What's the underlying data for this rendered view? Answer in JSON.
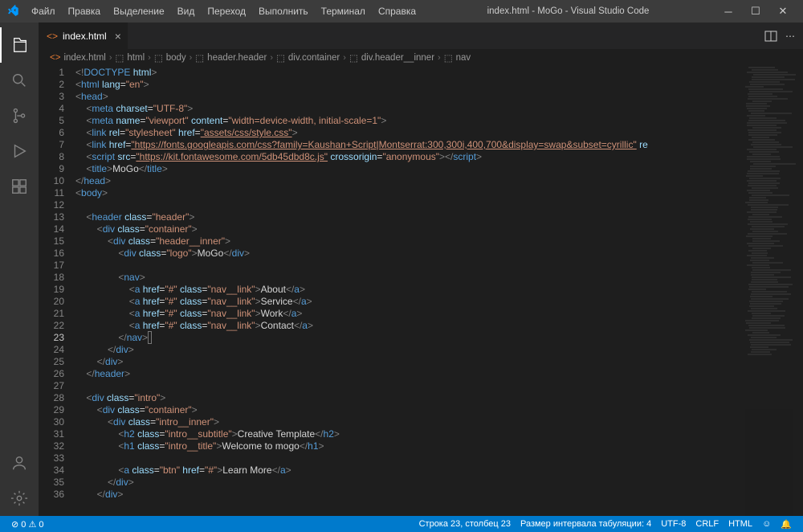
{
  "title": "index.html - MoGo - Visual Studio Code",
  "menu": [
    "Файл",
    "Правка",
    "Выделение",
    "Вид",
    "Переход",
    "Выполнить",
    "Терминал",
    "Справка"
  ],
  "tab": {
    "name": "index.html"
  },
  "breadcrumb": [
    "index.html",
    "html",
    "body",
    "header.header",
    "div.container",
    "div.header__inner",
    "nav"
  ],
  "code": {
    "lines": [
      {
        "n": 1,
        "html": "<span class='t-pct'>&lt;!</span><span class='t-doctype'>DOCTYPE</span> <span class='t-attr'>html</span><span class='t-pct'>&gt;</span>"
      },
      {
        "n": 2,
        "html": "<span class='t-pct'>&lt;</span><span class='t-tag'>html</span> <span class='t-attr'>lang</span>=<span class='t-str'>\"en\"</span><span class='t-pct'>&gt;</span>"
      },
      {
        "n": 3,
        "html": "<span class='t-pct'>&lt;</span><span class='t-tag'>head</span><span class='t-pct'>&gt;</span>"
      },
      {
        "n": 4,
        "html": "    <span class='t-pct'>&lt;</span><span class='t-tag'>meta</span> <span class='t-attr'>charset</span>=<span class='t-str'>\"UTF-8\"</span><span class='t-pct'>&gt;</span>"
      },
      {
        "n": 5,
        "html": "    <span class='t-pct'>&lt;</span><span class='t-tag'>meta</span> <span class='t-attr'>name</span>=<span class='t-str'>\"viewport\"</span> <span class='t-attr'>content</span>=<span class='t-str'>\"width=device-width, initial-scale=1\"</span><span class='t-pct'>&gt;</span>"
      },
      {
        "n": 6,
        "html": "    <span class='t-pct'>&lt;</span><span class='t-tag'>link</span> <span class='t-attr'>rel</span>=<span class='t-str'>\"stylesheet\"</span> <span class='t-attr'>href</span>=<span class='t-link'>\"assets/css/style.css\"</span><span class='t-pct'>&gt;</span>"
      },
      {
        "n": 7,
        "html": "    <span class='t-pct'>&lt;</span><span class='t-tag'>link</span> <span class='t-attr'>href</span>=<span class='t-link'>\"https://fonts.googleapis.com/css?family=Kaushan+Script|Montserrat:300,300i,400,700&amp;display=swap&amp;subset=cyrillic\"</span> <span class='t-attr'>re</span>"
      },
      {
        "n": 8,
        "html": "    <span class='t-pct'>&lt;</span><span class='t-tag'>script</span> <span class='t-attr'>src</span>=<span class='t-link'>\"https://kit.fontawesome.com/5db45dbd8c.js\"</span> <span class='t-attr'>crossorigin</span>=<span class='t-str'>\"anonymous\"</span><span class='t-pct'>&gt;&lt;/</span><span class='t-tag'>script</span><span class='t-pct'>&gt;</span>"
      },
      {
        "n": 9,
        "html": "    <span class='t-pct'>&lt;</span><span class='t-tag'>title</span><span class='t-pct'>&gt;</span><span class='t-text'>MoGo</span><span class='t-pct'>&lt;/</span><span class='t-tag'>title</span><span class='t-pct'>&gt;</span>"
      },
      {
        "n": 10,
        "html": "<span class='t-pct'>&lt;/</span><span class='t-tag'>head</span><span class='t-pct'>&gt;</span>"
      },
      {
        "n": 11,
        "html": "<span class='t-pct'>&lt;</span><span class='t-tag'>body</span><span class='t-pct'>&gt;</span>"
      },
      {
        "n": 12,
        "html": ""
      },
      {
        "n": 13,
        "html": "    <span class='t-pct'>&lt;</span><span class='t-tag'>header</span> <span class='t-attr'>class</span>=<span class='t-str'>\"header\"</span><span class='t-pct'>&gt;</span>"
      },
      {
        "n": 14,
        "html": "        <span class='t-pct'>&lt;</span><span class='t-tag'>div</span> <span class='t-attr'>class</span>=<span class='t-str'>\"container\"</span><span class='t-pct'>&gt;</span>"
      },
      {
        "n": 15,
        "html": "            <span class='t-pct'>&lt;</span><span class='t-tag'>div</span> <span class='t-attr'>class</span>=<span class='t-str'>\"header__inner\"</span><span class='t-pct'>&gt;</span>"
      },
      {
        "n": 16,
        "html": "                <span class='t-pct'>&lt;</span><span class='t-tag'>div</span> <span class='t-attr'>class</span>=<span class='t-str'>\"logo\"</span><span class='t-pct'>&gt;</span><span class='t-text'>MoGo</span><span class='t-pct'>&lt;/</span><span class='t-tag'>div</span><span class='t-pct'>&gt;</span>"
      },
      {
        "n": 17,
        "html": ""
      },
      {
        "n": 18,
        "html": "                <span class='t-pct'>&lt;</span><span class='t-tag'>nav</span><span class='t-pct'>&gt;</span>"
      },
      {
        "n": 19,
        "html": "                    <span class='t-pct'>&lt;</span><span class='t-tag'>a</span> <span class='t-attr'>href</span>=<span class='t-str'>\"#\"</span> <span class='t-attr'>class</span>=<span class='t-str'>\"nav__link\"</span><span class='t-pct'>&gt;</span><span class='t-text'>About</span><span class='t-pct'>&lt;/</span><span class='t-tag'>a</span><span class='t-pct'>&gt;</span>"
      },
      {
        "n": 20,
        "html": "                    <span class='t-pct'>&lt;</span><span class='t-tag'>a</span> <span class='t-attr'>href</span>=<span class='t-str'>\"#\"</span> <span class='t-attr'>class</span>=<span class='t-str'>\"nav__link\"</span><span class='t-pct'>&gt;</span><span class='t-text'>Service</span><span class='t-pct'>&lt;/</span><span class='t-tag'>a</span><span class='t-pct'>&gt;</span>"
      },
      {
        "n": 21,
        "html": "                    <span class='t-pct'>&lt;</span><span class='t-tag'>a</span> <span class='t-attr'>href</span>=<span class='t-str'>\"#\"</span> <span class='t-attr'>class</span>=<span class='t-str'>\"nav__link\"</span><span class='t-pct'>&gt;</span><span class='t-text'>Work</span><span class='t-pct'>&lt;/</span><span class='t-tag'>a</span><span class='t-pct'>&gt;</span>"
      },
      {
        "n": 22,
        "html": "                    <span class='t-pct'>&lt;</span><span class='t-tag'>a</span> <span class='t-attr'>href</span>=<span class='t-str'>\"#\"</span> <span class='t-attr'>class</span>=<span class='t-str'>\"nav__link\"</span><span class='t-pct'>&gt;</span><span class='t-text'>Contact</span><span class='t-pct'>&lt;/</span><span class='t-tag'>a</span><span class='t-pct'>&gt;</span>"
      },
      {
        "n": 23,
        "html": "                <span class='t-pct'>&lt;/</span><span class='t-tag'>nav</span><span class='t-pct'>&gt;</span><span style='border:1px solid #777;'>&nbsp;</span>",
        "current": true
      },
      {
        "n": 24,
        "html": "            <span class='t-pct'>&lt;/</span><span class='t-tag'>div</span><span class='t-pct'>&gt;</span>"
      },
      {
        "n": 25,
        "html": "        <span class='t-pct'>&lt;/</span><span class='t-tag'>div</span><span class='t-pct'>&gt;</span>"
      },
      {
        "n": 26,
        "html": "    <span class='t-pct'>&lt;/</span><span class='t-tag'>header</span><span class='t-pct'>&gt;</span>"
      },
      {
        "n": 27,
        "html": ""
      },
      {
        "n": 28,
        "html": "    <span class='t-pct'>&lt;</span><span class='t-tag'>div</span> <span class='t-attr'>class</span>=<span class='t-str'>\"intro\"</span><span class='t-pct'>&gt;</span>"
      },
      {
        "n": 29,
        "html": "        <span class='t-pct'>&lt;</span><span class='t-tag'>div</span> <span class='t-attr'>class</span>=<span class='t-str'>\"container\"</span><span class='t-pct'>&gt;</span>"
      },
      {
        "n": 30,
        "html": "            <span class='t-pct'>&lt;</span><span class='t-tag'>div</span> <span class='t-attr'>class</span>=<span class='t-str'>\"intro__inner\"</span><span class='t-pct'>&gt;</span>"
      },
      {
        "n": 31,
        "html": "                <span class='t-pct'>&lt;</span><span class='t-tag'>h2</span> <span class='t-attr'>class</span>=<span class='t-str'>\"intro__subtitle\"</span><span class='t-pct'>&gt;</span><span class='t-text'>Creative Template</span><span class='t-pct'>&lt;/</span><span class='t-tag'>h2</span><span class='t-pct'>&gt;</span>"
      },
      {
        "n": 32,
        "html": "                <span class='t-pct'>&lt;</span><span class='t-tag'>h1</span> <span class='t-attr'>class</span>=<span class='t-str'>\"intro__title\"</span><span class='t-pct'>&gt;</span><span class='t-text'>Welcome to mogo</span><span class='t-pct'>&lt;/</span><span class='t-tag'>h1</span><span class='t-pct'>&gt;</span>"
      },
      {
        "n": 33,
        "html": ""
      },
      {
        "n": 34,
        "html": "                <span class='t-pct'>&lt;</span><span class='t-tag'>a</span> <span class='t-attr'>class</span>=<span class='t-str'>\"btn\"</span> <span class='t-attr'>href</span>=<span class='t-str'>\"#\"</span><span class='t-pct'>&gt;</span><span class='t-text'>Learn More</span><span class='t-pct'>&lt;/</span><span class='t-tag'>a</span><span class='t-pct'>&gt;</span>"
      },
      {
        "n": 35,
        "html": "            <span class='t-pct'>&lt;/</span><span class='t-tag'>div</span><span class='t-pct'>&gt;</span>"
      },
      {
        "n": 36,
        "html": "        <span class='t-pct'>&lt;/</span><span class='t-tag'>div</span><span class='t-pct'>&gt;</span>"
      }
    ]
  },
  "status": {
    "left": "⊘ 0 ⚠ 0",
    "lncol": "Строка 23, столбец 23",
    "tab": "Размер интервала табуляции: 4",
    "enc": "UTF-8",
    "eol": "CRLF",
    "lang": "HTML",
    "feedback": "☺"
  }
}
